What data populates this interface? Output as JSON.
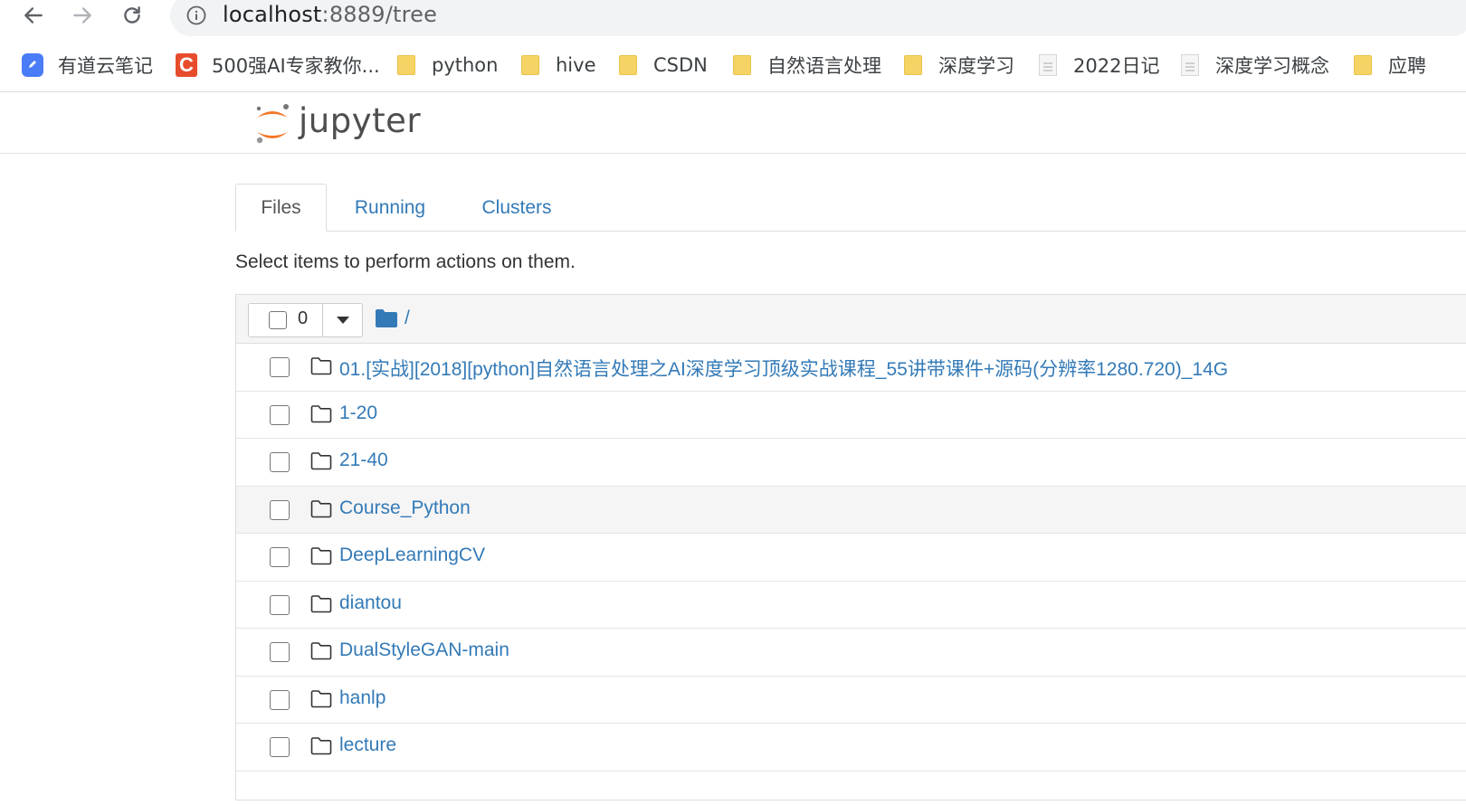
{
  "browser": {
    "url_host": "localhost",
    "url_path": ":8889/tree",
    "back_icon": "back-arrow-icon",
    "forward_icon": "forward-arrow-icon",
    "reload_icon": "reload-icon",
    "info_icon": "info-icon"
  },
  "bookmarks": [
    {
      "label": "有道云笔记",
      "icon": "youdao-icon"
    },
    {
      "label": "500强AI专家教你...",
      "icon": "csdn-icon"
    },
    {
      "label": "python",
      "icon": "folder-icon"
    },
    {
      "label": "hive",
      "icon": "folder-icon"
    },
    {
      "label": "CSDN",
      "icon": "folder-icon"
    },
    {
      "label": "自然语言处理",
      "icon": "folder-icon"
    },
    {
      "label": "深度学习",
      "icon": "folder-icon"
    },
    {
      "label": "2022日记",
      "icon": "page-icon"
    },
    {
      "label": "深度学习概念",
      "icon": "page-icon"
    },
    {
      "label": "应聘",
      "icon": "folder-icon"
    }
  ],
  "header": {
    "logo_text": "jupyter"
  },
  "tabs": [
    {
      "label": "Files",
      "active": true
    },
    {
      "label": "Running",
      "active": false
    },
    {
      "label": "Clusters",
      "active": false
    }
  ],
  "instructions": "Select items to perform actions on them.",
  "list": {
    "selected_count": "0",
    "breadcrumb_root": "/",
    "items": [
      {
        "name": "01.[实战][2018][python]自然语言处理之AI深度学习顶级实战课程_55讲带课件+源码(分辨率1280.720)_14G",
        "type": "folder"
      },
      {
        "name": "1-20",
        "type": "folder"
      },
      {
        "name": "21-40",
        "type": "folder"
      },
      {
        "name": "Course_Python",
        "type": "folder"
      },
      {
        "name": "DeepLearningCV",
        "type": "folder"
      },
      {
        "name": "diantou",
        "type": "folder"
      },
      {
        "name": "DualStyleGAN-main",
        "type": "folder"
      },
      {
        "name": "hanlp",
        "type": "folder"
      },
      {
        "name": "lecture",
        "type": "folder"
      }
    ]
  },
  "colors": {
    "link": "#337ab7",
    "jupyter_orange": "#f37626",
    "header_bg": "#f5f5f5"
  }
}
